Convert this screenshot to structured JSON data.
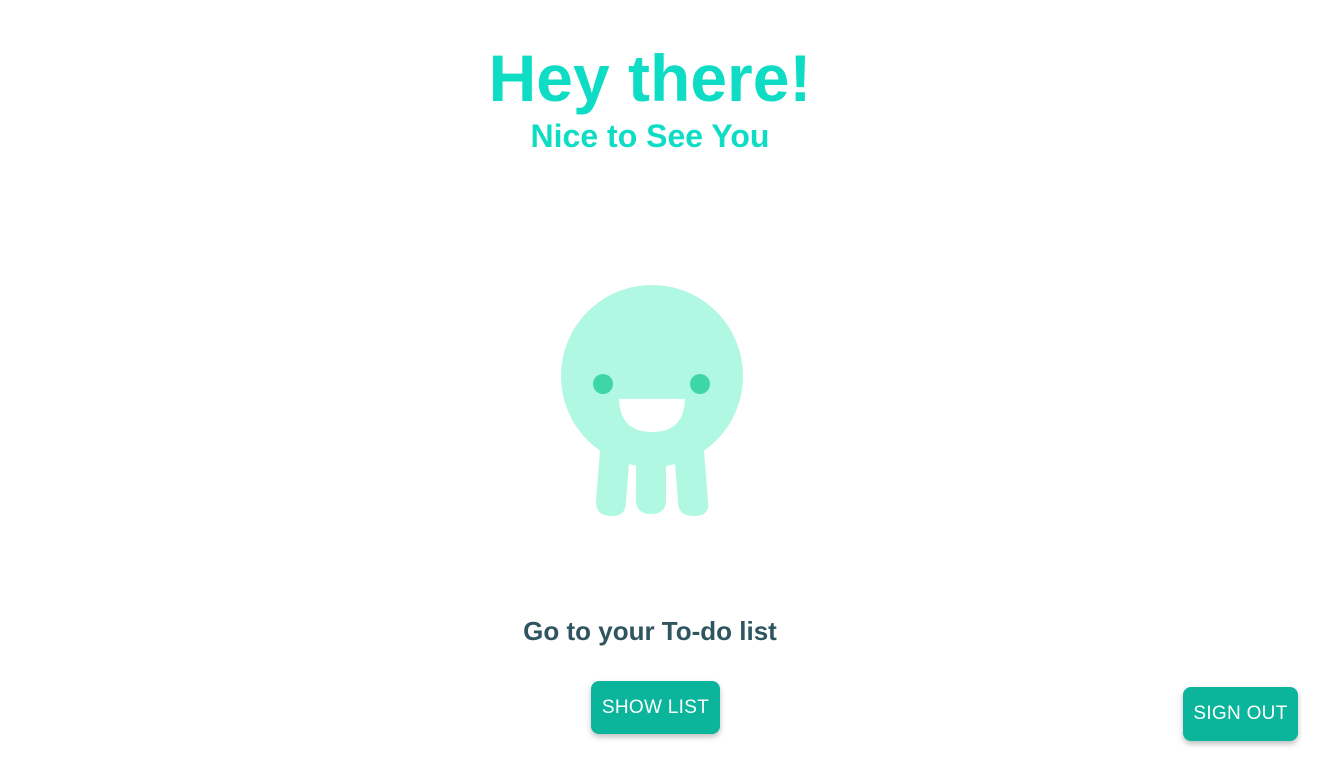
{
  "header": {
    "title": "Hey there!",
    "subtitle": "Nice to See You"
  },
  "main": {
    "mascot_icon": "happy-octopus-icon",
    "prompt": "Go to your To-do list",
    "show_list_label": "SHOW LIST"
  },
  "footer": {
    "sign_out_label": "SIGN OUT"
  },
  "colors": {
    "accent": "#0fdcc4",
    "button": "#0ab59b",
    "mascot_body": "#b1f8e2",
    "mascot_eyes": "#3fd6a6",
    "text_dark": "#2f5560"
  }
}
